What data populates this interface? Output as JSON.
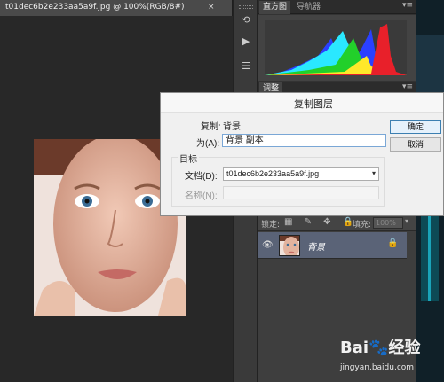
{
  "document": {
    "tab_title": "t01dec6b2e233aa5a9f.jpg @ 100%(RGB/8#)",
    "close_glyph": "×"
  },
  "tool_strip": {
    "icons": [
      "history-icon",
      "play-icon",
      "clone-source-icon"
    ]
  },
  "panels": {
    "histogram_tab": "直方图",
    "navigator_tab": "导航器",
    "adjustments_tab": "调整",
    "menu_glyph": "▾≡"
  },
  "layers": {
    "lock_label": "锁定:",
    "lock_icons": "▦ ✎ ✥ 🔒",
    "fill_label": "填充:",
    "fill_value": "100%",
    "layer_name": "背景",
    "eye_glyph": "👁",
    "lock_glyph": "🔒"
  },
  "dialog": {
    "title": "复制图层",
    "copy_label": "复制:",
    "copy_value": "背景",
    "as_label": "为(A):",
    "as_value": "背景 副本",
    "target_legend": "目标",
    "document_label": "文档(D):",
    "document_value": "t01dec6b2e233aa5a9f.jpg",
    "name_label": "名称(N):",
    "ok_label": "确定",
    "cancel_label": "取消"
  },
  "watermark": {
    "logo_text": "Bai🐾经验",
    "url": "jingyan.baidu.com"
  },
  "colors": {
    "panel_bg": "#333333",
    "dialog_bg": "#f0f0f0",
    "layer_selected": "#5a6377",
    "histogram_red": "#e8202a",
    "histogram_green": "#22d02a",
    "histogram_blue": "#2a40ff",
    "histogram_cyan": "#2ae8ff",
    "histogram_yellow": "#ffe82a"
  }
}
